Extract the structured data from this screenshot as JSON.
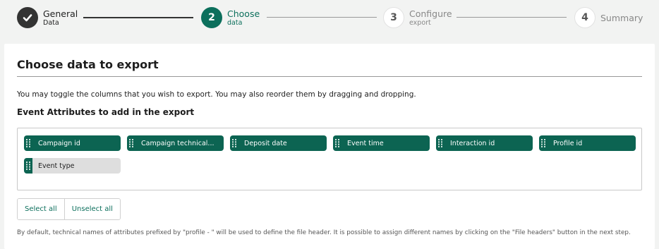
{
  "stepper": {
    "steps": [
      {
        "number": "1",
        "title": "General",
        "subtitle": "Data",
        "state": "done",
        "icon": "check-icon"
      },
      {
        "number": "2",
        "title": "Choose",
        "subtitle": "data",
        "state": "active"
      },
      {
        "number": "3",
        "title": "Configure",
        "subtitle": "export",
        "state": "todo"
      },
      {
        "number": "4",
        "title": "Summary",
        "subtitle": "",
        "state": "todo"
      }
    ]
  },
  "card": {
    "title": "Choose data to export",
    "description": "You may toggle the columns that you wish to export. You may also reorder them by dragging and dropping.",
    "section_title": "Event Attributes to add in the export"
  },
  "attributes": [
    {
      "label": "Campaign id",
      "selected": true
    },
    {
      "label": "Campaign technical...",
      "selected": true
    },
    {
      "label": "Deposit date",
      "selected": true
    },
    {
      "label": "Event time",
      "selected": true
    },
    {
      "label": "Interaction id",
      "selected": true
    },
    {
      "label": "Profile id",
      "selected": true
    },
    {
      "label": "Event type",
      "selected": false
    }
  ],
  "actions": {
    "select_all": "Select all",
    "unselect_all": "Unselect all"
  },
  "footnote": "By default, technical names of attributes prefixed by \"profile - \" will be used to define the file header. It is possible to assign different names by clicking on the \"File headers\" button in the next step.",
  "colors": {
    "accent": "#0c6f5c",
    "chip_selected": "#0c6452",
    "chip_unselected": "#dedede",
    "done_step": "#333333"
  }
}
